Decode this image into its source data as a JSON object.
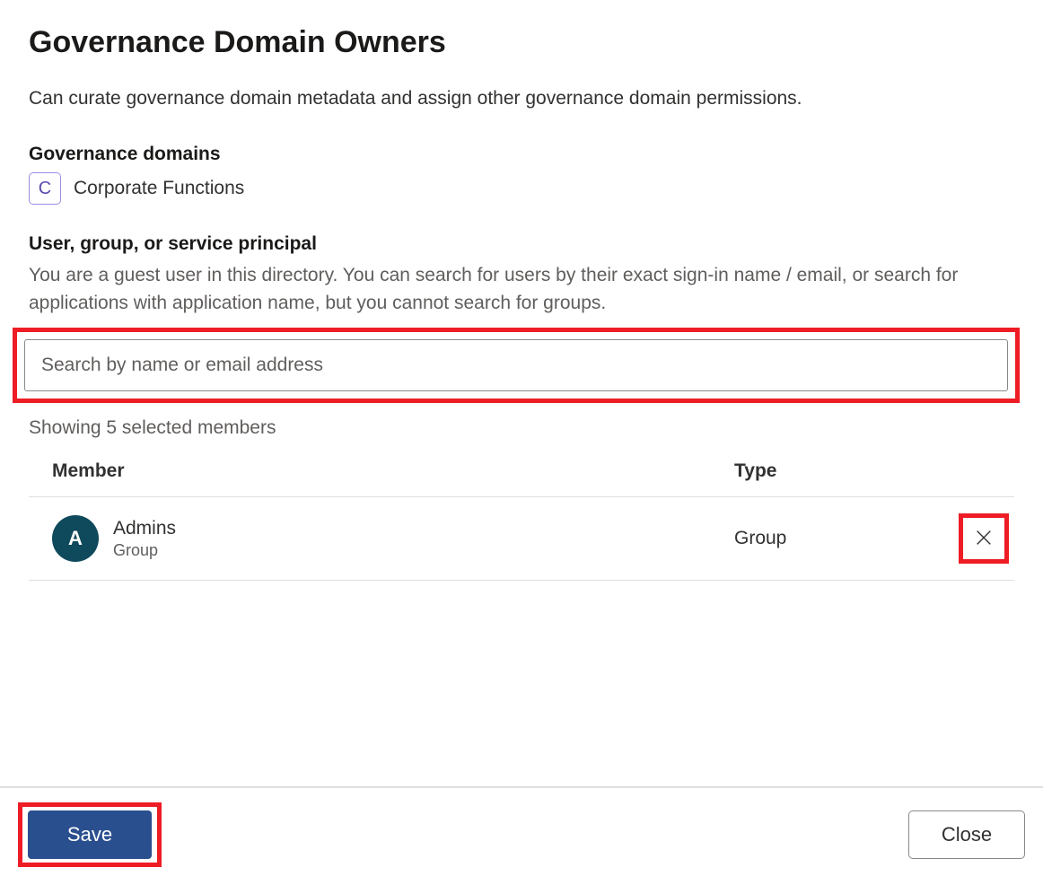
{
  "header": {
    "title": "Governance Domain Owners",
    "subtitle": "Can curate governance domain metadata and assign other governance domain permissions."
  },
  "domains": {
    "label": "Governance domains",
    "item": {
      "letter": "C",
      "name": "Corporate Functions"
    }
  },
  "principal": {
    "label": "User, group, or service principal",
    "help": "You are a guest user in this directory. You can search for users by their exact sign-in name / email, or search for applications with application name, but you cannot search for groups."
  },
  "search": {
    "placeholder": "Search by name or email address",
    "value": ""
  },
  "members": {
    "countText": "Showing 5 selected members",
    "columns": {
      "member": "Member",
      "type": "Type"
    },
    "rows": [
      {
        "initial": "A",
        "name": "Admins",
        "subtype": "Group",
        "type": "Group"
      }
    ]
  },
  "footer": {
    "save": "Save",
    "close": "Close"
  }
}
